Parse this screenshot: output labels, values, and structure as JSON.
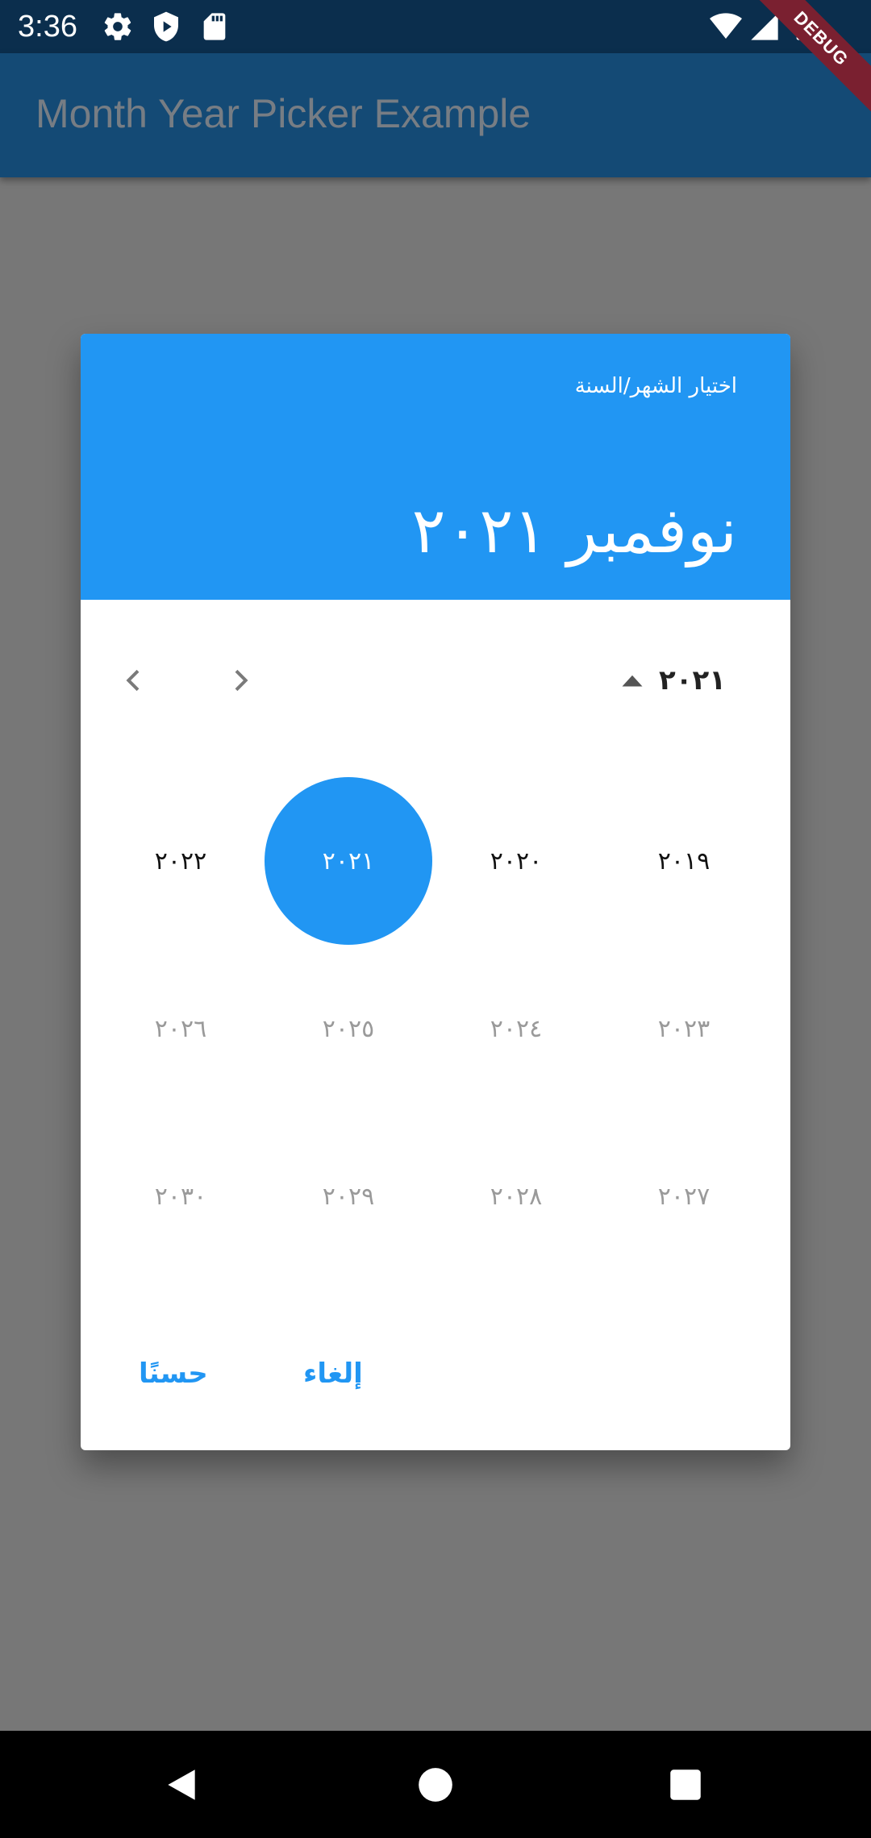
{
  "status_bar": {
    "time": "3:36",
    "left_icons": [
      "settings-icon",
      "shield-icon",
      "sd-card-icon"
    ],
    "right_icons": [
      "wifi-icon",
      "signal-icon",
      "battery-icon"
    ]
  },
  "app_bar": {
    "title": "Month Year Picker Example",
    "debug_banner": "DEBUG"
  },
  "dialog": {
    "help_text": "اختيار الشهر/السنة",
    "selected_label": "نوفمبر ٢٠٢١",
    "year_switch_label": "٢٠٢١",
    "rows": [
      [
        {
          "label": "٢٠٢٢",
          "state": "enabled"
        },
        {
          "label": "٢٠٢١",
          "state": "selected"
        },
        {
          "label": "٢٠٢٠",
          "state": "enabled"
        },
        {
          "label": "٢٠١٩",
          "state": "enabled"
        }
      ],
      [
        {
          "label": "٢٠٢٦",
          "state": "disabled"
        },
        {
          "label": "٢٠٢٥",
          "state": "disabled"
        },
        {
          "label": "٢٠٢٤",
          "state": "disabled"
        },
        {
          "label": "٢٠٢٣",
          "state": "disabled"
        }
      ],
      [
        {
          "label": "٢٠٣٠",
          "state": "disabled"
        },
        {
          "label": "٢٠٢٩",
          "state": "disabled"
        },
        {
          "label": "٢٠٢٨",
          "state": "disabled"
        },
        {
          "label": "٢٠٢٧",
          "state": "disabled"
        }
      ]
    ],
    "ok_label": "حسنًا",
    "cancel_label": "إلغاء"
  },
  "colors": {
    "primary": "#2196f3",
    "app_bar": "#144a75",
    "status_bar": "#0b2e4d",
    "scrim": "#777777"
  }
}
